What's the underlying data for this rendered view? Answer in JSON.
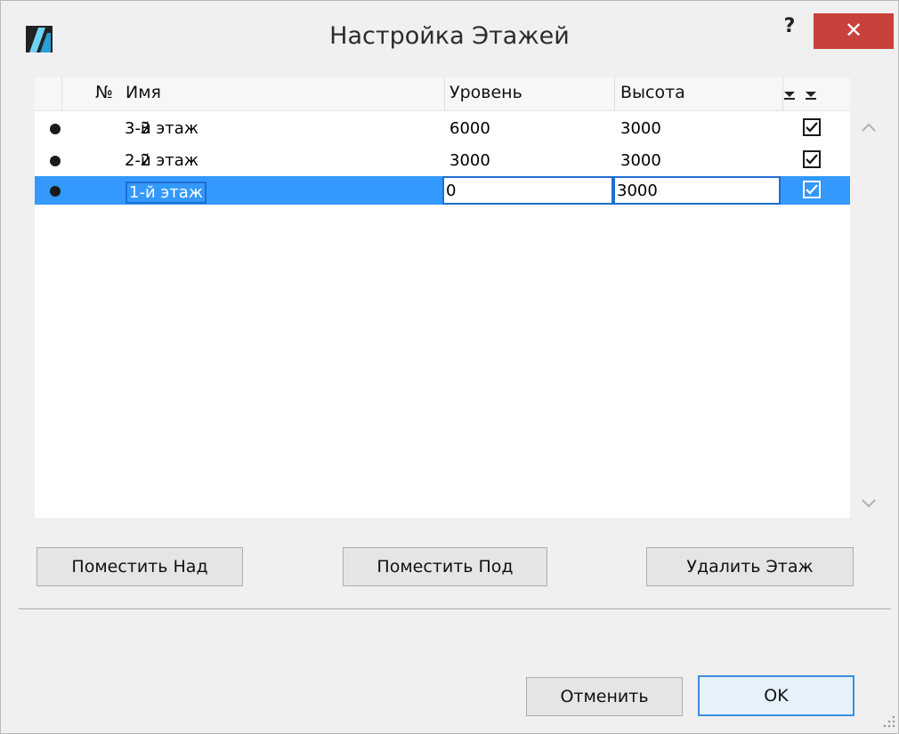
{
  "window": {
    "title": "Настройка Этажей",
    "help_label": "?",
    "close_label": "✕"
  },
  "table": {
    "columns": {
      "number": "№",
      "name": "Имя",
      "level": "Уровень",
      "height": "Высота"
    },
    "rows": [
      {
        "number": "3",
        "name": "3-й этаж",
        "level": "6000",
        "height": "3000",
        "checked": true,
        "selected": false
      },
      {
        "number": "2",
        "name": "2-й этаж",
        "level": "3000",
        "height": "3000",
        "checked": true,
        "selected": false
      },
      {
        "number": "1",
        "name": "1-й этаж",
        "level": "0",
        "height": "3000",
        "checked": true,
        "selected": true
      }
    ]
  },
  "actions": {
    "place_above": "Поместить Над",
    "place_below": "Поместить Под",
    "delete_story": "Удалить Этаж"
  },
  "footer": {
    "cancel": "Отменить",
    "ok": "OK"
  },
  "colors": {
    "selection": "#3399ff",
    "close_button": "#c8413b"
  }
}
